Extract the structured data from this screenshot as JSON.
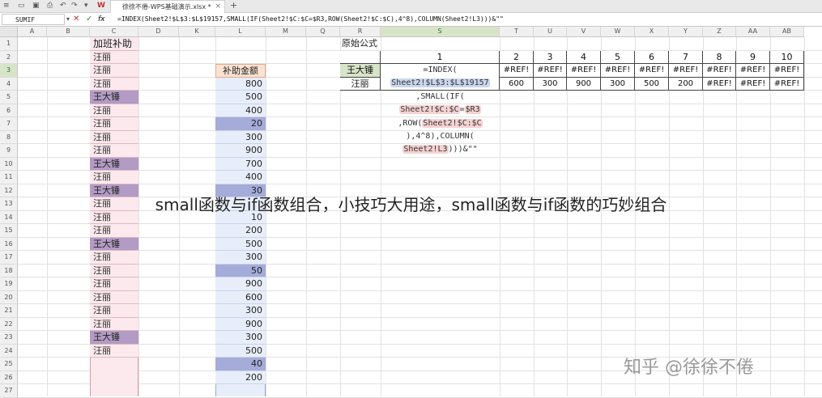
{
  "tabbar": {
    "file_tab": "徐徐不倦-WPS基础演示.xlsx *",
    "new_tab": "+"
  },
  "formula_bar": {
    "name_box": "SUMIF",
    "cancel_icon": "✕",
    "enter_icon": "✓",
    "fx": "fx",
    "formula": "=INDEX(Sheet2!$L$3:$L$19157,SMALL(IF(Sheet2!$C:$C=$R3,ROW(Sheet2!$C:$C),4^8),COLUMN(Sheet2!L3)))&\"\""
  },
  "columns": [
    "A",
    "B",
    "C",
    "D",
    "K",
    "L",
    "M",
    "Q",
    "R",
    "S",
    "T",
    "U",
    "V",
    "W",
    "X",
    "Y",
    "Z",
    "AA",
    "AB"
  ],
  "selected_column": "S",
  "rows": [
    "1",
    "2",
    "3",
    "4",
    "5",
    "6",
    "7",
    "8",
    "9",
    "10",
    "11",
    "12",
    "13",
    "14",
    "15",
    "16",
    "17",
    "18",
    "19",
    "20",
    "21",
    "22",
    "23",
    "24",
    "25",
    "26",
    "27"
  ],
  "col_c": {
    "header": "加班补助",
    "cells": [
      {
        "text": "汪丽",
        "hl": false
      },
      {
        "text": "汪丽",
        "hl": false
      },
      {
        "text": "汪丽",
        "hl": false
      },
      {
        "text": "王大锤",
        "hl": true
      },
      {
        "text": "汪丽",
        "hl": false
      },
      {
        "text": "汪丽",
        "hl": false
      },
      {
        "text": "汪丽",
        "hl": false
      },
      {
        "text": "汪丽",
        "hl": false
      },
      {
        "text": "王大锤",
        "hl": true
      },
      {
        "text": "汪丽",
        "hl": false
      },
      {
        "text": "王大锤",
        "hl": true
      },
      {
        "text": "汪丽",
        "hl": false
      },
      {
        "text": "汪丽",
        "hl": false
      },
      {
        "text": "汪丽",
        "hl": false
      },
      {
        "text": "王大锤",
        "hl": true
      },
      {
        "text": "汪丽",
        "hl": false
      },
      {
        "text": "汪丽",
        "hl": false
      },
      {
        "text": "汪丽",
        "hl": false
      },
      {
        "text": "汪丽",
        "hl": false
      },
      {
        "text": "汪丽",
        "hl": false
      },
      {
        "text": "汪丽",
        "hl": false
      },
      {
        "text": "王大锤",
        "hl": true
      },
      {
        "text": "汪丽",
        "hl": false
      }
    ]
  },
  "col_l": {
    "header": "补助金额",
    "cells": [
      {
        "text": "800",
        "hl": false
      },
      {
        "text": "500",
        "hl": false
      },
      {
        "text": "400",
        "hl": false
      },
      {
        "text": "20",
        "hl": true
      },
      {
        "text": "300",
        "hl": false
      },
      {
        "text": "900",
        "hl": false
      },
      {
        "text": "700",
        "hl": false
      },
      {
        "text": "400",
        "hl": false
      },
      {
        "text": "30",
        "hl": true
      },
      {
        "text": "",
        "hl": false
      },
      {
        "text": "10",
        "hl": false
      },
      {
        "text": "200",
        "hl": false
      },
      {
        "text": "500",
        "hl": false
      },
      {
        "text": "300",
        "hl": false
      },
      {
        "text": "50",
        "hl": true
      },
      {
        "text": "900",
        "hl": false
      },
      {
        "text": "600",
        "hl": false
      },
      {
        "text": "300",
        "hl": false
      },
      {
        "text": "900",
        "hl": false
      },
      {
        "text": "300",
        "hl": false
      },
      {
        "text": "500",
        "hl": false
      },
      {
        "text": "40",
        "hl": true
      },
      {
        "text": "200",
        "hl": false
      }
    ]
  },
  "table": {
    "title": "原始公式",
    "col_numbers": [
      "1",
      "2",
      "3",
      "4",
      "5",
      "6",
      "7",
      "8",
      "9",
      "10"
    ],
    "row1_name": "王大锤",
    "row2_name": "汪丽",
    "row1_values": [
      "#REF!",
      "#REF!",
      "#REF!",
      "#REF!",
      "#REF!",
      "#REF!",
      "#REF!",
      "#REF!",
      "#REF!"
    ],
    "row2_values": [
      "600",
      "300",
      "900",
      "300",
      "500",
      "200",
      "#REF!",
      "#REF!",
      "#REF!"
    ],
    "formula_lines": [
      [
        "=INDEX("
      ],
      [
        "Sheet2!$L$3:$L$19157"
      ],
      [
        ",SMALL(IF("
      ],
      [
        "Sheet2!$C:$C",
        "=",
        "$R3"
      ],
      [
        ",ROW(",
        "Sheet2!$C:$C"
      ],
      [
        "),4^8),COLUMN("
      ],
      [
        "Sheet2!L3",
        ")))&\"\""
      ]
    ]
  },
  "banner": "small函数与if函数组合，小技巧大用途，small函数与if函数的巧妙组合",
  "watermark": "知乎 @徐徐不倦"
}
